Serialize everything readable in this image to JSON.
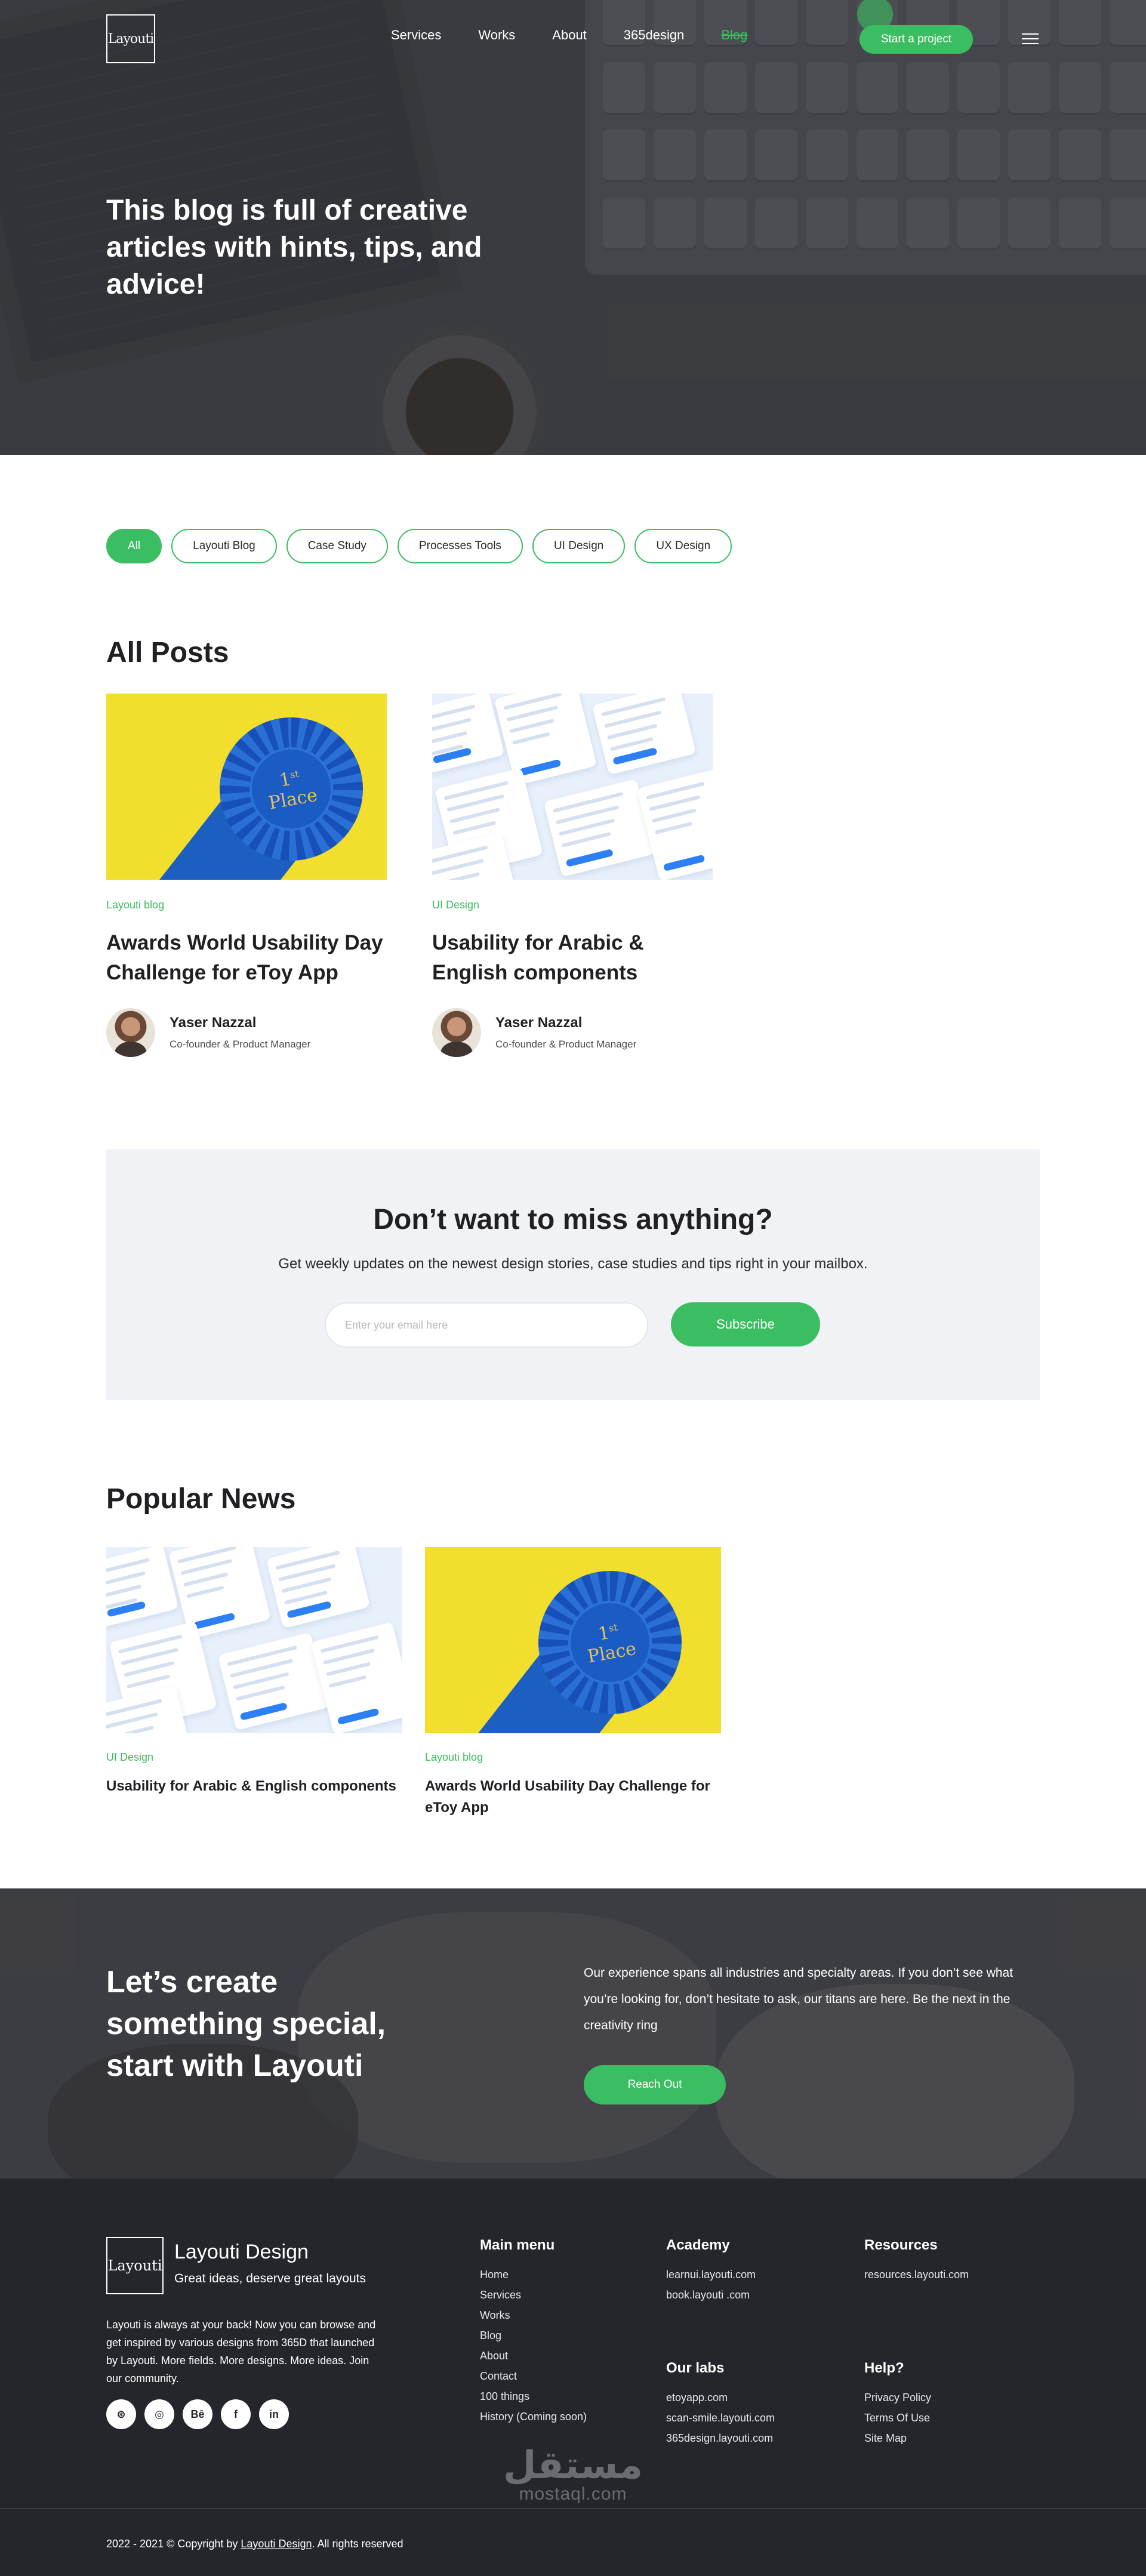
{
  "nav": {
    "logo_text": "Layouti",
    "links": [
      "Services",
      "Works",
      "About",
      "365design",
      "Blog"
    ],
    "active_index": 4,
    "cta": "Start a project"
  },
  "hero": {
    "title": "This blog is full of creative articles with hints, tips, and advice!"
  },
  "filters": {
    "items": [
      "All",
      "Layouti Blog",
      "Case Study",
      "Processes Tools",
      "UI Design",
      "UX Design"
    ],
    "active_index": 0
  },
  "all_posts": {
    "heading": "All Posts",
    "posts": [
      {
        "category": "Layouti blog",
        "title": "Awards World Usability Day Challenge for eToy App",
        "author": "Yaser Nazzal",
        "role": "Co-founder & Product Manager",
        "image": "rosette"
      },
      {
        "category": "UI Design",
        "title": "Usability for Arabic & English components",
        "author": "Yaser Nazzal",
        "role": "Co-founder & Product Manager",
        "image": "ui"
      }
    ]
  },
  "newsletter": {
    "title": "Don’t want to miss anything?",
    "subtitle": "Get weekly updates on the newest design stories, case studies and tips right in your mailbox.",
    "placeholder": "Enter your email here",
    "button": "Subscribe"
  },
  "popular": {
    "heading": "Popular News",
    "posts": [
      {
        "category": "UI Design",
        "title": "Usability for Arabic & English components",
        "image": "ui"
      },
      {
        "category": "Layouti blog",
        "title": "Awards World Usability Day Challenge for eToy App",
        "image": "rosette"
      }
    ]
  },
  "cta": {
    "title": "Let’s create something special, start with Layouti",
    "text": "Our experience spans all industries and specialty areas. If you don’t see what you’re looking for, don’t hesitate to ask, our titans are here. Be the next in the creativity ring",
    "button": "Reach Out"
  },
  "footer": {
    "logo_text": "Layouti",
    "brand": "Layouti Design",
    "tagline": "Great ideas, deserve great layouts",
    "description": "Layouti is always at your back! Now you can browse and get inspired by various designs from 365D that launched by Layouti. More fields. More designs. More ideas. Join our community.",
    "socials": [
      {
        "icon": "dribbble-icon",
        "glyph": "⊛"
      },
      {
        "icon": "instagram-icon",
        "glyph": "◎"
      },
      {
        "icon": "behance-icon",
        "glyph": "Bē"
      },
      {
        "icon": "facebook-icon",
        "glyph": "f"
      },
      {
        "icon": "linkedin-icon",
        "glyph": "in"
      }
    ],
    "main_menu": {
      "heading": "Main menu",
      "items": [
        "Home",
        "Services",
        "Works",
        "Blog",
        "About",
        "Contact",
        "100 things",
        "History (Coming soon)"
      ]
    },
    "academy": {
      "heading": "Academy",
      "items": [
        "learnui.layouti.com",
        "book.layouti .com"
      ]
    },
    "labs": {
      "heading": "Our labs",
      "items": [
        "etoyapp.com",
        "scan-smile.layouti.com",
        "365design.layouti.com"
      ]
    },
    "resources": {
      "heading": "Resources",
      "items": [
        "resources.layouti.com"
      ]
    },
    "help": {
      "heading": "Help?",
      "items": [
        "Privacy Policy",
        "Terms Of Use",
        "Site Map"
      ]
    },
    "copyright_prefix": "2022 - 2021 © Copyright by ",
    "copyright_link": "Layouti Design",
    "copyright_suffix": ". All rights reserved",
    "watermark_ar": "مستقل",
    "watermark_lat": "mostaql.com"
  },
  "colors": {
    "accent": "#3bbe61",
    "footer_bg": "#25262b",
    "newsletter_bg": "#f1f2f5"
  }
}
